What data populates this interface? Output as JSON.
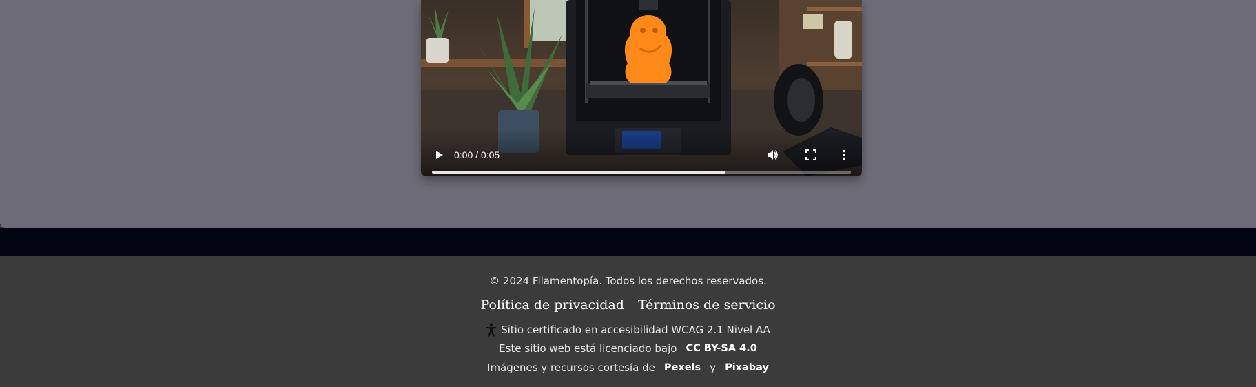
{
  "video": {
    "time_display": "0:00 / 0:05",
    "progress_fraction": 0.7,
    "controls": {
      "play_icon": "play-icon",
      "volume_icon": "volume-icon",
      "fullscreen_icon": "fullscreen-icon",
      "more_icon": "more-vertical-icon"
    }
  },
  "footer": {
    "copyright": "© 2024 Filamentopía. Todos los derechos reservados.",
    "privacy_label": "Política de privacidad",
    "terms_label": "Términos de servicio",
    "accessibility_text": "Sitio certificado en accesibilidad WCAG 2.1 Nivel AA",
    "accessibility_icon": "accessibility-icon",
    "license_prefix": "Este sitio web está licenciado bajo",
    "license_link": "CC BY-SA 4.0",
    "credits_prefix": "Imágenes y recursos cortesía de",
    "credits_link_1": "Pexels",
    "credits_joiner": "y",
    "credits_link_2": "Pixabay"
  },
  "colors": {
    "main_panel": "#6d6c78",
    "dark_band": "#020412",
    "footer_bg": "#3b3b3b",
    "footer_text": "#e9e9e9"
  }
}
